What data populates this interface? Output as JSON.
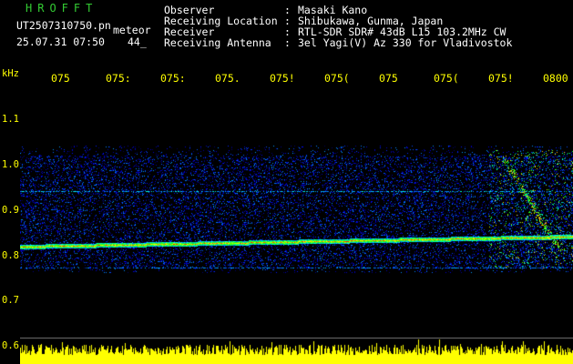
{
  "header": {
    "title": "HROFFT",
    "filename": "UT2507310750.pn",
    "mode": "meteor",
    "datetime": "25.07.31 07:50",
    "count": "44_",
    "info_labels": [
      "Observer",
      "Receiving Location",
      "Receiver",
      "Receiving Antenna"
    ],
    "info_values": [
      "Masaki Kano",
      "Shibukawa, Gunma, Japan",
      "RTL-SDR SDR# 43dB L15 103.2MHz CW",
      "3el Yagi(V) Az 330 for Vladivostok"
    ]
  },
  "time_axis": {
    "ticks": [
      "075",
      "075:",
      "075:",
      "075.",
      "075!",
      "075(",
      "075",
      "075(",
      "075!",
      "0800"
    ]
  },
  "freq_axis": {
    "unit": "kHz",
    "labels": [
      "1.1",
      "1.0",
      "0.9",
      "0.8",
      "0.7",
      "0.6"
    ]
  },
  "colors": {
    "background": "#000000",
    "title": "#33cc33",
    "header_text": "#ffffff",
    "axis_text": "#ffff00",
    "signal_bar": "#ffff00"
  }
}
